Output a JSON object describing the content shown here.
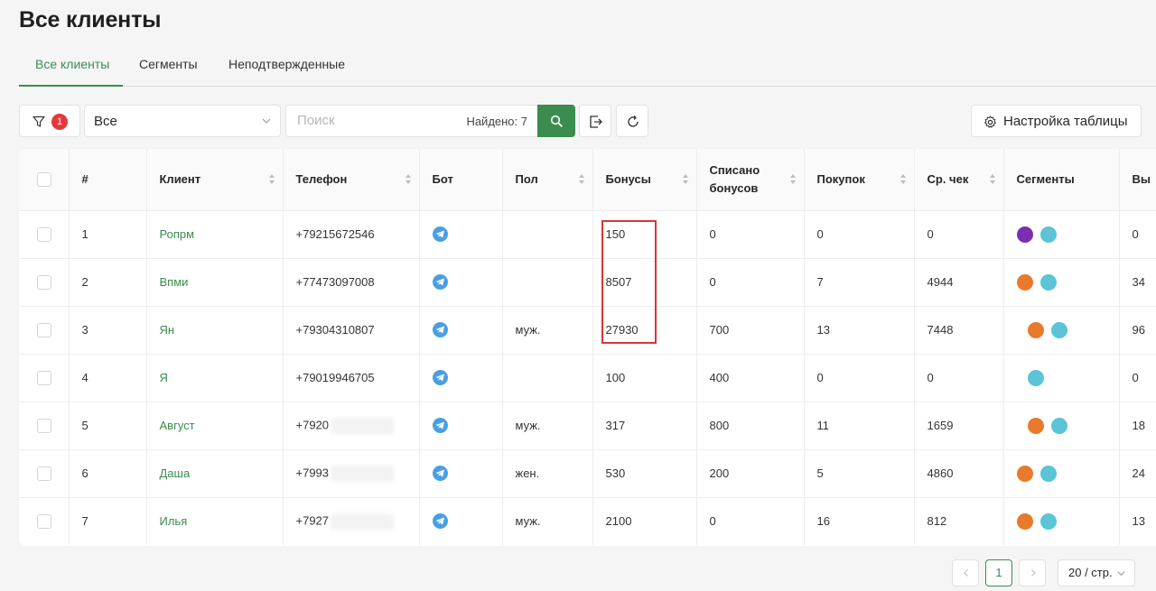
{
  "page_title": "Все клиенты",
  "tabs": [
    {
      "label": "Все клиенты",
      "active": true
    },
    {
      "label": "Сегменты",
      "active": false
    },
    {
      "label": "Неподтвержденные",
      "active": false
    }
  ],
  "toolbar": {
    "filter_badge": "1",
    "select_value": "Все",
    "search_placeholder": "Поиск",
    "found_text": "Найдено: 7",
    "settings_label": "Настройка таблицы"
  },
  "table": {
    "headers": [
      "#",
      "Клиент",
      "Телефон",
      "Бот",
      "Пол",
      "Бонусы",
      "Списано бонусов",
      "Покупок",
      "Ср. чек",
      "Сегменты",
      "Вы"
    ],
    "rows": [
      {
        "num": "1",
        "name": "Ропрм",
        "phone": "+79215672546",
        "gender": "",
        "bonus": "150",
        "spent": "0",
        "purchases": "0",
        "avg": "0",
        "segments": [
          "#7b2fb0",
          "#5bc4d6"
        ],
        "last": "0"
      },
      {
        "num": "2",
        "name": "Впми",
        "phone": "+77473097008",
        "gender": "",
        "bonus": "8507",
        "spent": "0",
        "purchases": "7",
        "avg": "4944",
        "segments": [
          "#e9792b",
          "#5bc4d6"
        ],
        "last": "34"
      },
      {
        "num": "3",
        "name": "Ян",
        "phone": "+79304310807",
        "gender": "муж.",
        "bonus": "27930",
        "spent": "700",
        "purchases": "13",
        "avg": "7448",
        "segments": [
          "#e9792b",
          "#5bc4d6"
        ],
        "last": "96"
      },
      {
        "num": "4",
        "name": "Я",
        "phone": "+79019946705",
        "gender": "",
        "bonus": "100",
        "spent": "400",
        "purchases": "0",
        "avg": "0",
        "segments": [
          "#5bc4d6"
        ],
        "last": "0"
      },
      {
        "num": "5",
        "name": "Август",
        "phone": "+7920",
        "gender": "муж.",
        "bonus": "317",
        "spent": "800",
        "purchases": "11",
        "avg": "1659",
        "segments": [
          "#e9792b",
          "#5bc4d6"
        ],
        "last": "18"
      },
      {
        "num": "6",
        "name": "Даша",
        "phone": "+7993",
        "gender": "жен.",
        "bonus": "530",
        "spent": "200",
        "purchases": "5",
        "avg": "4860",
        "segments": [
          "#e9792b",
          "#5bc4d6"
        ],
        "last": "24"
      },
      {
        "num": "7",
        "name": "Илья",
        "phone": "+7927",
        "gender": "муж.",
        "bonus": "2100",
        "spent": "0",
        "purchases": "16",
        "avg": "812",
        "segments": [
          "#e9792b",
          "#5bc4d6"
        ],
        "last": "13"
      }
    ]
  },
  "pagination": {
    "current_page": "1",
    "page_size": "20 / стр."
  },
  "colors": {
    "accent": "#3a8d4f",
    "badge": "#e5383b",
    "highlight": "#d8353a",
    "telegram": "#4a9fe3"
  }
}
